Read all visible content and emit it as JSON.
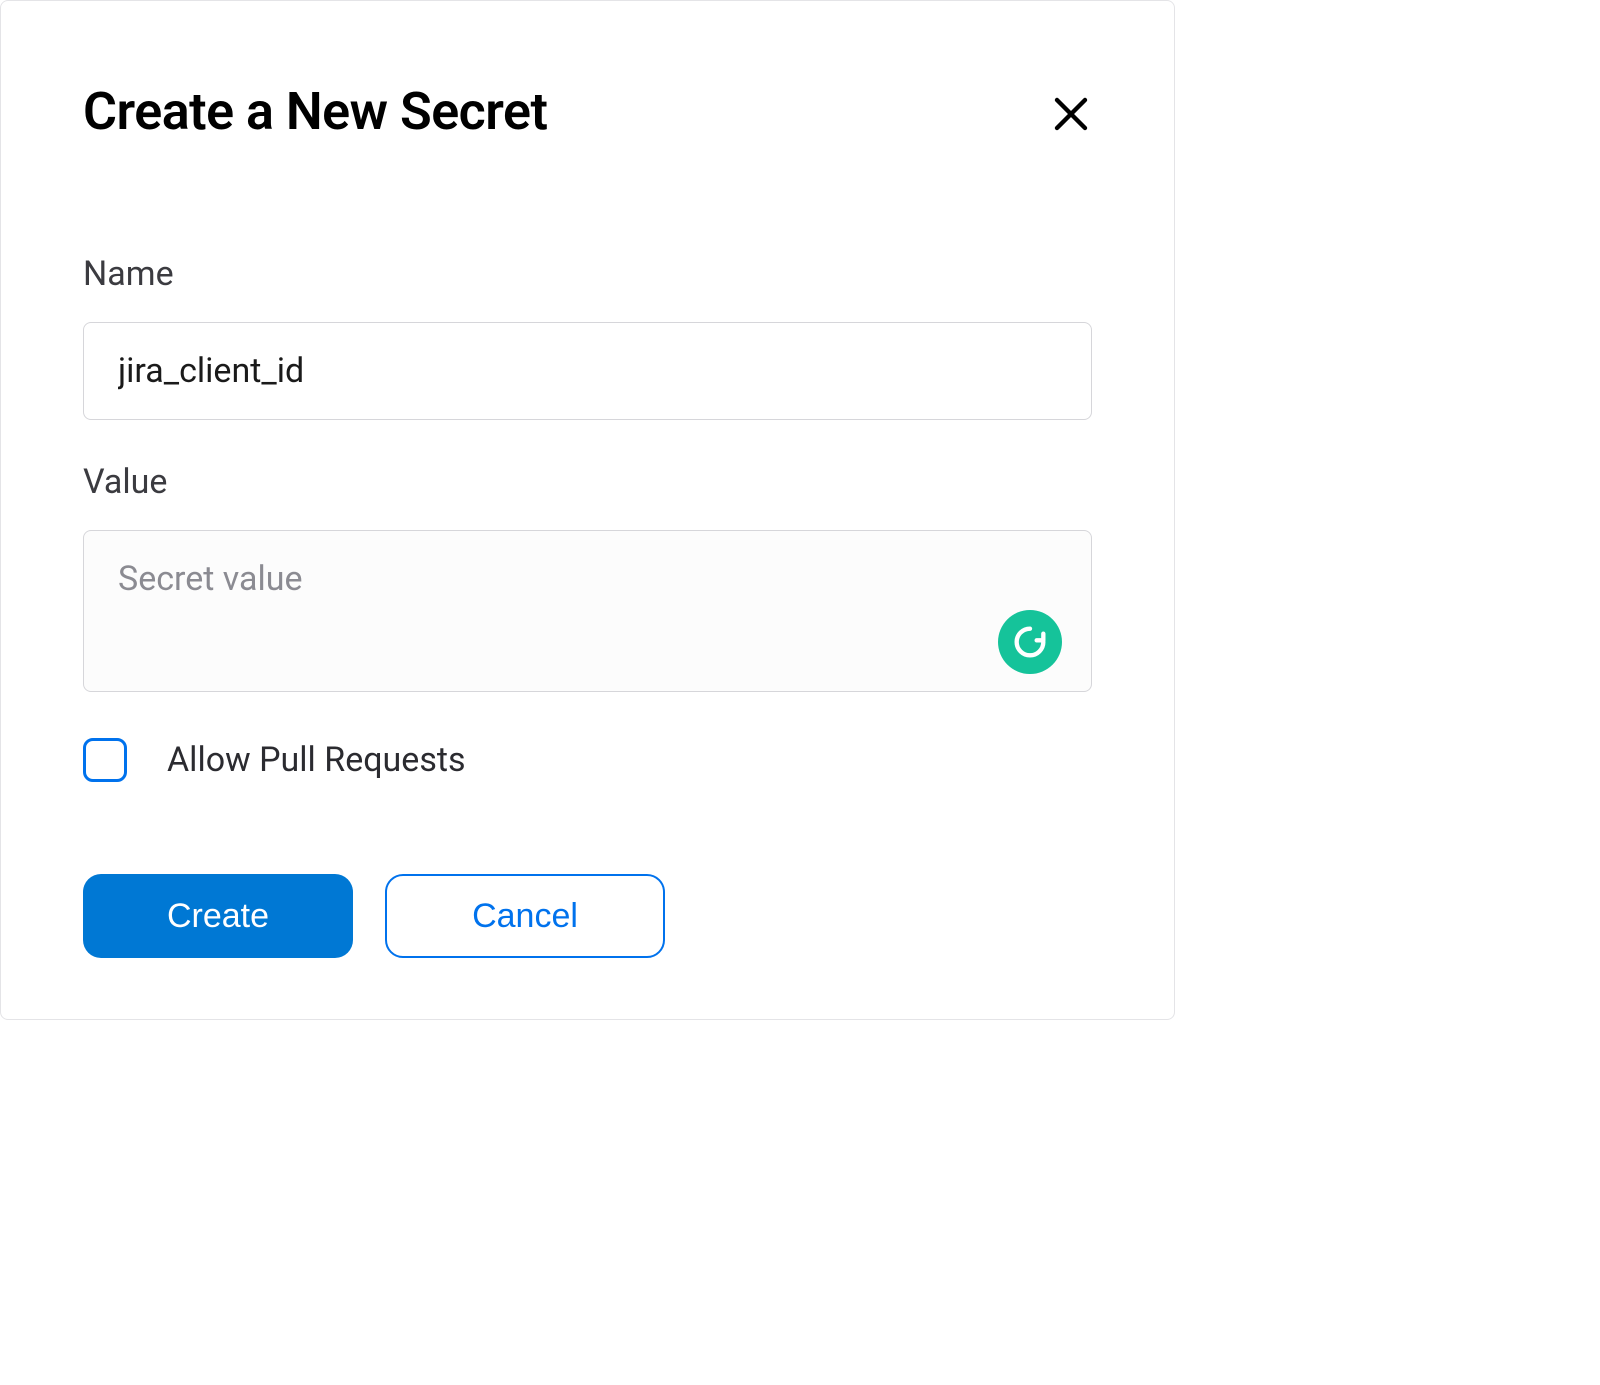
{
  "modal": {
    "title": "Create a New Secret",
    "fields": {
      "name": {
        "label": "Name",
        "value": "jira_client_id"
      },
      "value": {
        "label": "Value",
        "placeholder": "Secret value",
        "value": ""
      }
    },
    "checkbox": {
      "label": "Allow Pull Requests",
      "checked": false
    },
    "buttons": {
      "primary": "Create",
      "secondary": "Cancel"
    }
  }
}
